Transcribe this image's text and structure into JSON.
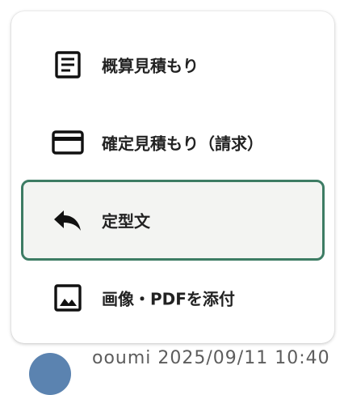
{
  "menu": {
    "items": [
      {
        "label": "概算見積もり",
        "icon": "document-icon",
        "selected": false
      },
      {
        "label": "確定見積もり（請求）",
        "icon": "credit-card-icon",
        "selected": false
      },
      {
        "label": "定型文",
        "icon": "reply-icon",
        "selected": true
      },
      {
        "label": "画像・PDFを添付",
        "icon": "image-icon",
        "selected": false
      }
    ]
  },
  "background": {
    "partial_text": "ooumi 2025/09/11 10:40"
  },
  "colors": {
    "selected_border": "#3d7c64",
    "text": "#222222",
    "avatar": "#5b83b0"
  }
}
